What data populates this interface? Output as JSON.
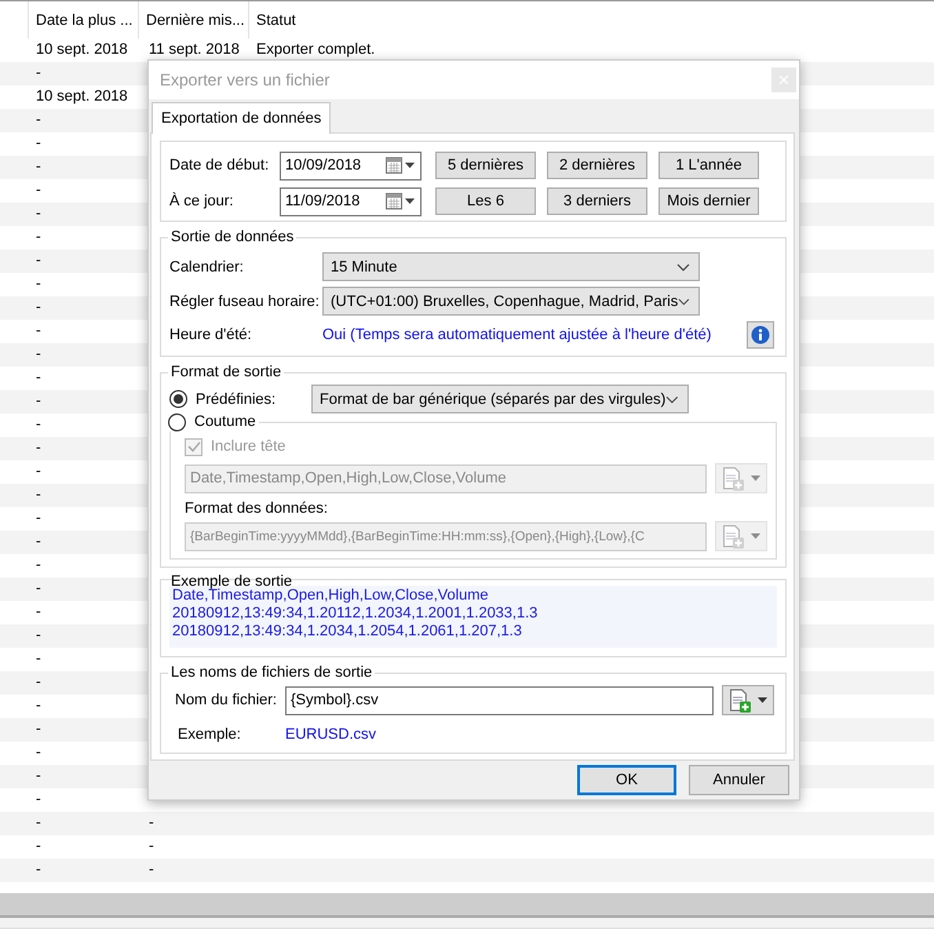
{
  "background_table": {
    "columns": [
      "Date la plus ...",
      "Dernière mis...",
      "Statut"
    ],
    "rows": [
      {
        "cells": [
          "10 sept. 2018",
          "11 sept. 2018",
          "Exporter complet."
        ]
      },
      {
        "cells": [
          "-"
        ]
      },
      {
        "cells": [
          "10 sept. 2018"
        ]
      },
      {
        "cells": [
          "-"
        ]
      },
      {
        "cells": [
          "-"
        ]
      },
      {
        "cells": [
          "-"
        ]
      },
      {
        "cells": [
          "-"
        ]
      },
      {
        "cells": [
          "-"
        ]
      },
      {
        "cells": [
          "-"
        ]
      },
      {
        "cells": [
          "-"
        ]
      },
      {
        "cells": [
          "-"
        ]
      },
      {
        "cells": [
          "-"
        ]
      },
      {
        "cells": [
          "-"
        ]
      },
      {
        "cells": [
          "-"
        ]
      },
      {
        "cells": [
          "-"
        ]
      },
      {
        "cells": [
          "-"
        ]
      },
      {
        "cells": [
          "-"
        ]
      },
      {
        "cells": [
          "-"
        ]
      },
      {
        "cells": [
          "-"
        ]
      },
      {
        "cells": [
          "-"
        ]
      },
      {
        "cells": [
          "-"
        ]
      },
      {
        "cells": [
          "-"
        ]
      },
      {
        "cells": [
          "-"
        ]
      },
      {
        "cells": [
          "-"
        ]
      },
      {
        "cells": [
          "-"
        ]
      },
      {
        "cells": [
          "-"
        ]
      },
      {
        "cells": [
          "-"
        ]
      },
      {
        "cells": [
          "-"
        ]
      },
      {
        "cells": [
          "-"
        ]
      },
      {
        "cells": [
          "-"
        ]
      },
      {
        "cells": [
          "-"
        ]
      },
      {
        "cells": [
          "-"
        ]
      },
      {
        "cells": [
          "-"
        ]
      },
      {
        "cells": [
          "-",
          "-"
        ]
      },
      {
        "cells": [
          "-",
          "-"
        ]
      },
      {
        "cells": [
          "-",
          "-"
        ]
      }
    ]
  },
  "dialog": {
    "title": "Exporter vers un fichier",
    "tabs": [
      {
        "label": "Exportation de données",
        "selected": true
      }
    ],
    "date_range": {
      "start": {
        "label": "Date de début:",
        "value": "10/09/2018"
      },
      "end": {
        "label": "À ce jour:",
        "value": "11/09/2018"
      },
      "quick_buttons": [
        "5 dernières",
        "2 dernières",
        "1 L'année",
        "Les 6",
        "3 derniers",
        "Mois dernier"
      ]
    },
    "data_output": {
      "title": "Sortie de données",
      "calendar": {
        "label": "Calendrier:",
        "value": "15 Minute"
      },
      "timezone": {
        "label": "Régler fuseau horaire:",
        "value": "(UTC+01:00) Bruxelles, Copenhague, Madrid, Paris"
      },
      "dst": {
        "label": "Heure d'été:",
        "value": "Oui (Temps sera automatiquement ajustée à l'heure d'été)"
      }
    },
    "output_format": {
      "title": "Format de sortie",
      "predefined": {
        "label": "Prédéfinies:",
        "selected": true,
        "value": "Format de bar générique (séparés par des virgules)"
      },
      "custom": {
        "label": "Coutume",
        "selected": false,
        "include_header": {
          "label": "Inclure tête",
          "checked": true
        },
        "header_value": "Date,Timestamp,Open,High,Low,Close,Volume",
        "data_format_label": "Format des données:",
        "data_format_value": "{BarBeginTime:yyyyMMdd},{BarBeginTime:HH:mm:ss},{Open},{High},{Low},{C"
      }
    },
    "sample": {
      "title": "Exemple de sortie",
      "lines": [
        "Date,Timestamp,Open,High,Low,Close,Volume",
        "20180912,13:49:34,1.20112,1.2034,1.2001,1.2033,1.3",
        "20180912,13:49:34,1.2034,1.2054,1.2061,1.207,1.3"
      ]
    },
    "file_names": {
      "title": "Les noms de fichiers de sortie",
      "file_name": {
        "label": "Nom du fichier:",
        "value": "{Symbol}.csv"
      },
      "example": {
        "label": "Exemple:",
        "value": "EURUSD.csv"
      }
    },
    "buttons": [
      {
        "label": "OK",
        "default": true
      },
      {
        "label": "Annuler",
        "default": false
      }
    ]
  }
}
